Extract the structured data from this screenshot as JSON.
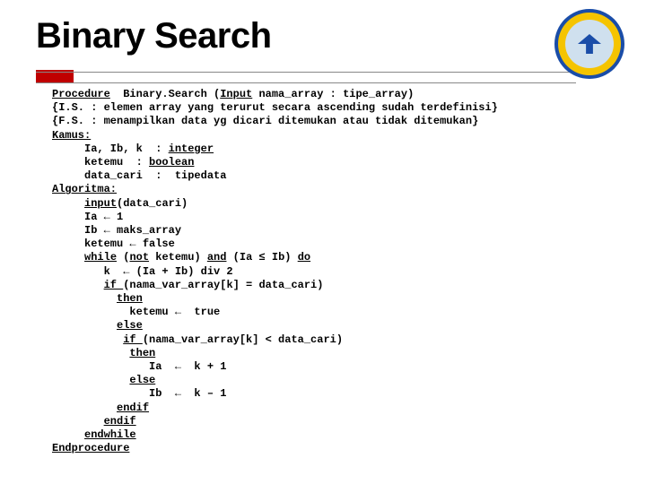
{
  "title": "Binary Search",
  "logo_alt": "Universitas Komputer Indonesia",
  "code": {
    "l1a": "Procedure",
    "l1b": "  Binary.Search (",
    "l1c": "Input",
    "l1d": " nama_array : tipe_array)",
    "l2": "{I.S. : elemen array yang terurut secara ascending sudah terdefinisi}",
    "l3": "{F.S. : menampilkan data yg dicari ditemukan atau tidak ditemukan}",
    "l4": "Kamus:",
    "l5a": "     Ia, Ib, k  : ",
    "l5b": "integer",
    "l6a": "     ketemu  : ",
    "l6b": "boolean",
    "l7": "     data_cari  :  tipedata",
    "l8": "Algoritma:",
    "l9a": "     ",
    "l9b": "input",
    "l9c": "(data_cari)",
    "l10": "     Ia ← 1",
    "l11": "     Ib ← maks_array",
    "l12": "     ketemu ← false",
    "l13a": "     ",
    "l13b": "while",
    "l13c": " (",
    "l13d": "not",
    "l13e": " ketemu) ",
    "l13f": "and",
    "l13g": " (Ia ≤ Ib) ",
    "l13h": "do",
    "l14": "        k  ← (Ia + Ib) div 2",
    "l15a": "        ",
    "l15b": "if ",
    "l15c": "(nama_var_array[k] = data_cari)",
    "l16a": "          ",
    "l16b": "then",
    "l17": "            ketemu ←  true",
    "l18a": "          ",
    "l18b": "else",
    "l19a": "           ",
    "l19b": "if ",
    "l19c": "(nama_var_array[k] < data_cari)",
    "l20a": "            ",
    "l20b": "then",
    "l21": "               Ia  ←  k + 1",
    "l22a": "            ",
    "l22b": "else",
    "l23": "               Ib  ←  k – 1",
    "l24a": "          ",
    "l24b": "endif",
    "l25a": "        ",
    "l25b": "endif",
    "l26a": "     ",
    "l26b": "endwhile",
    "l27": "Endprocedure"
  }
}
